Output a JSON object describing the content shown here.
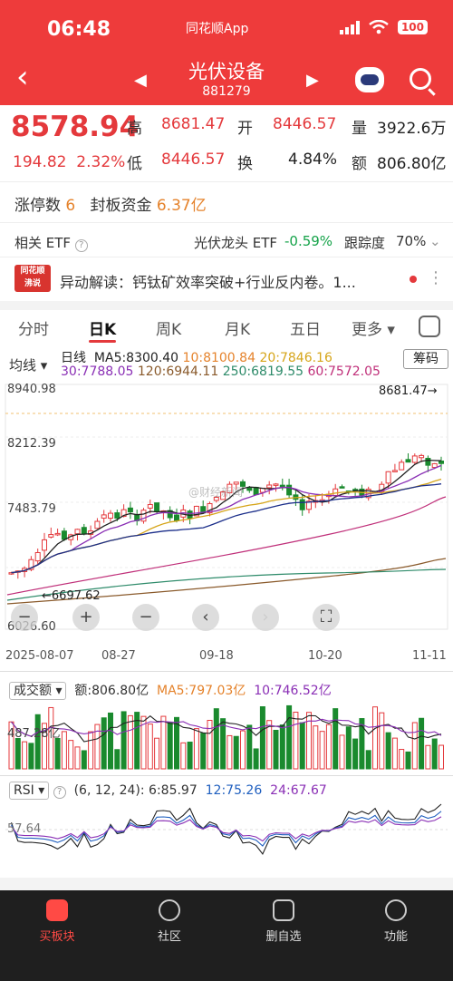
{
  "status": {
    "time": "06:48",
    "app_name": "同花顺App",
    "battery": "100"
  },
  "header": {
    "title": "光伏设备",
    "code": "881279"
  },
  "quote": {
    "price": "8578.94",
    "change": "194.82",
    "change_pct": "2.32%",
    "high_label": "高",
    "high": "8681.47",
    "open_label": "开",
    "open": "8446.57",
    "vol_label": "量",
    "volume": "3922.6万",
    "low_label": "低",
    "low": "8446.57",
    "turnover_label": "换",
    "turnover": "4.84%",
    "amount_label": "额",
    "amount": "806.80亿"
  },
  "limit": {
    "count_label": "涨停数",
    "count": "6",
    "fund_label": "封板资金",
    "fund": "6.37亿"
  },
  "etf": {
    "label": "相关 ETF",
    "name": "光伏龙头 ETF",
    "change": "-0.59%",
    "track_label": "跟踪度",
    "track": "70%"
  },
  "news": {
    "logo_top": "同花顺",
    "logo_bottom": "沸说",
    "text": "异动解读：钙钛矿效率突破+行业反内卷。1..."
  },
  "tabs": [
    "分时",
    "日K",
    "周K",
    "月K",
    "五日",
    "更多"
  ],
  "kline": {
    "ma_selector": "均线",
    "period": "日线",
    "ma5": "MA5:8300.40",
    "ma10": "10:8100.84",
    "ma20": "20:7846.16",
    "ma30": "30:7788.05",
    "ma120": "120:6944.11",
    "ma250": "250:6819.55",
    "ma60": "60:7572.05",
    "chip_button": "筹码",
    "y_top": "8940.98",
    "y_mid1": "8212.39",
    "y_mid2": "7483.79",
    "y_bottom": "6026.60",
    "high_marker": "8681.47",
    "low_marker": "6697.62",
    "dates": [
      "2025-08-07",
      "08-27",
      "09-18",
      "10-20",
      "11-11"
    ],
    "watermark": "@财经新闻"
  },
  "volume": {
    "selector": "成交额",
    "amount": "额:806.80亿",
    "ma5": "MA5:797.03亿",
    "ma10": "10:746.52亿",
    "y_label": "487.28亿"
  },
  "rsi": {
    "selector": "RSI",
    "params": "(6, 12, 24):",
    "r6": "6:85.97",
    "r12": "12:75.26",
    "r24": "24:67.67",
    "y_label": "57.64"
  },
  "colors": {
    "up": "#e4393c",
    "down": "#1a8a2e",
    "header": "#ee3b3b",
    "ma5": "#222222",
    "ma10": "#e5832c",
    "ma20": "#d6a51a",
    "ma30": "#8a2fb5",
    "ma60": "#c0307a",
    "ma120": "#8a5a2b",
    "ma250": "#2e8b6a"
  },
  "bottom_nav": [
    {
      "label": "买板块",
      "icon": "buy-icon"
    },
    {
      "label": "社区",
      "icon": "community-icon"
    },
    {
      "label": "删自选",
      "icon": "remove-watchlist-icon"
    },
    {
      "label": "功能",
      "icon": "menu-icon"
    }
  ]
}
